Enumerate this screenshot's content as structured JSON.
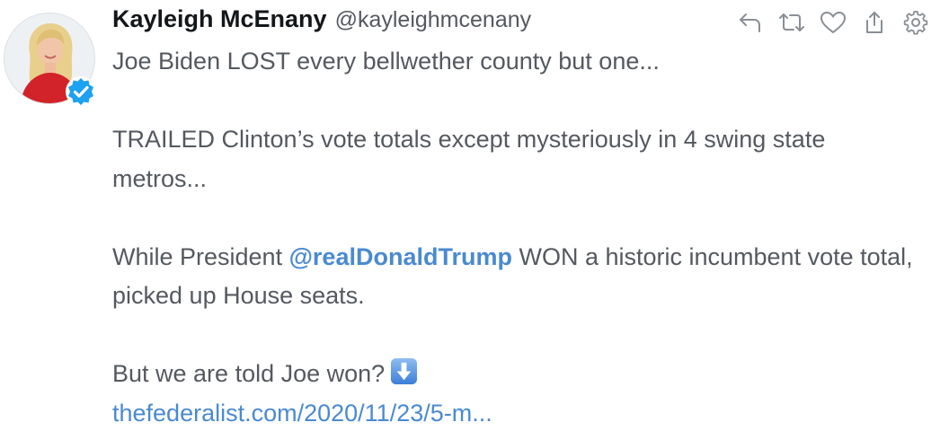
{
  "tweet": {
    "display_name": "Kayleigh McEnany",
    "handle": "@kayleighmcenany",
    "verified": true,
    "paragraphs": [
      {
        "text": "Joe Biden LOST every bellwether county but one..."
      },
      {
        "text": "TRAILED Clinton’s vote totals except mysteriously in 4 swing state metros..."
      },
      {
        "before": "While President ",
        "mention": "@realDonaldTrump",
        "after": " WON a historic incumbent vote total, picked up House seats."
      },
      {
        "text": "But we are told Joe won?",
        "emoji": "down-arrow-emoji",
        "link": "thefederalist.com/2020/11/23/5-m..."
      }
    ]
  },
  "actions": [
    {
      "name": "reply-icon"
    },
    {
      "name": "retweet-icon"
    },
    {
      "name": "like-heart-icon"
    },
    {
      "name": "share-icon"
    },
    {
      "name": "settings-gear-icon"
    }
  ],
  "colors": {
    "text": "#55595f",
    "name": "#14171a",
    "link": "#4a8ad0",
    "verified": "#1da1f2",
    "icon": "#8a8f95"
  }
}
